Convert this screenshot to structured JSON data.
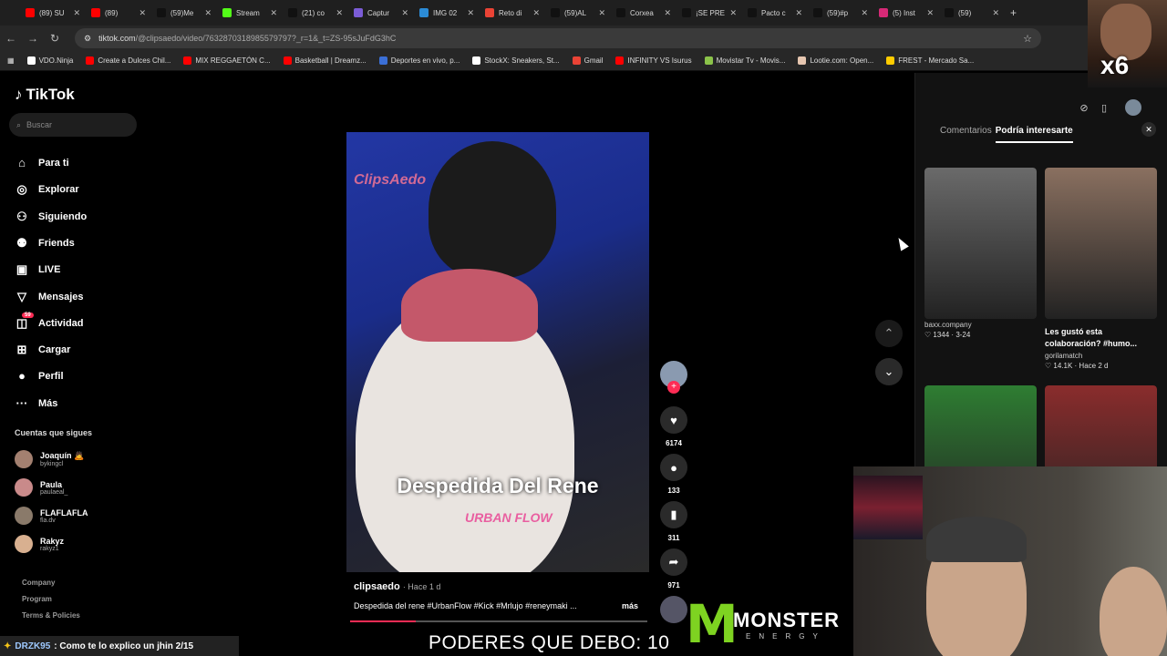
{
  "browser": {
    "tabs": [
      {
        "title": "(89) SU",
        "color": "#ff0000"
      },
      {
        "title": "(89)",
        "color": "#ff0000"
      },
      {
        "title": "(59)Me",
        "color": "#111111"
      },
      {
        "title": "Stream",
        "color": "#53fc18"
      },
      {
        "title": "(21) co",
        "color": "#111111"
      },
      {
        "title": "Captur",
        "color": "#7b5cd6"
      },
      {
        "title": "IMG 02",
        "color": "#2b8bd6"
      },
      {
        "title": "Reto di",
        "color": "#ea4335"
      },
      {
        "title": "(59)AL",
        "color": "#111111"
      },
      {
        "title": "Corxea",
        "color": "#111111"
      },
      {
        "title": "¡SE PRE",
        "color": "#111111"
      },
      {
        "title": "Pacto c",
        "color": "#111111"
      },
      {
        "title": "(59)#p",
        "color": "#111111"
      },
      {
        "title": "(5) Inst",
        "color": "#d62976"
      },
      {
        "title": "(59)",
        "color": "#111111"
      }
    ],
    "url_host": "tiktok.com",
    "url_path": "/@clipsaedo/video/7632870318985579797?_r=1&_t=ZS-95sJuFdG3hC",
    "bookmarks": [
      {
        "label": "VDO.Ninja",
        "color": "#ffffff"
      },
      {
        "label": "Create a Dulces Chil...",
        "color": "#ff0000"
      },
      {
        "label": "MIX REGGAETÓN C...",
        "color": "#ff0000"
      },
      {
        "label": "Basketball | Dreamz...",
        "color": "#ff0000"
      },
      {
        "label": "Deportes en vivo, p...",
        "color": "#3b6fd6"
      },
      {
        "label": "StockX: Sneakers, St...",
        "color": "#ffffff"
      },
      {
        "label": "Gmail",
        "color": "#ea4335"
      },
      {
        "label": "INFINITY VS Isurus",
        "color": "#ff0000"
      },
      {
        "label": "Movistar Tv - Movis...",
        "color": "#8bc34a"
      },
      {
        "label": "Lootie.com: Open...",
        "color": "#e6c6b0"
      },
      {
        "label": "FREST - Mercado Sa...",
        "color": "#ffcc00"
      }
    ]
  },
  "sidebar": {
    "logo": "TikTok",
    "search_placeholder": "Buscar",
    "nav": [
      {
        "label": "Para ti",
        "icon": "home-icon",
        "glyph": "⌂"
      },
      {
        "label": "Explorar",
        "icon": "compass-icon",
        "glyph": "◎"
      },
      {
        "label": "Siguiendo",
        "icon": "user-follow-icon",
        "glyph": "⚇"
      },
      {
        "label": "Friends",
        "icon": "friends-icon",
        "glyph": "⚉"
      },
      {
        "label": "LIVE",
        "icon": "live-icon",
        "glyph": "▣"
      },
      {
        "label": "Mensajes",
        "icon": "inbox-icon",
        "glyph": "▽"
      },
      {
        "label": "Actividad",
        "icon": "activity-icon",
        "glyph": "◫",
        "badge": "59"
      },
      {
        "label": "Cargar",
        "icon": "upload-icon",
        "glyph": "⊞"
      },
      {
        "label": "Perfil",
        "icon": "profile-avatar-icon",
        "glyph": "●"
      },
      {
        "label": "Más",
        "icon": "more-icon",
        "glyph": "···"
      }
    ],
    "following_title": "Cuentas que sigues",
    "following": [
      {
        "name": "Joaquín 🙇",
        "handle": "bykingcl",
        "color": "#a38070"
      },
      {
        "name": "Paula",
        "handle": "paulaeal_",
        "color": "#c98a8a"
      },
      {
        "name": "FLAFLAFLA",
        "handle": "fla.dv",
        "color": "#8a7a6a"
      },
      {
        "name": "Rakyz",
        "handle": "rakyz1",
        "color": "#d8b090"
      }
    ],
    "footer": [
      "Company",
      "Program",
      "Terms & Policies"
    ]
  },
  "video": {
    "watermark": "ClipsAedo",
    "caption_overlay": "Despedida Del Rene",
    "brand_overlay": "URBAN FLOW",
    "author": "clipsaedo",
    "ago": "· Hace 1 d",
    "description": "Despedida del rene #UrbanFlow #Kick #Mrlujo #reneymaki ...",
    "more": "más",
    "progress": 0.22
  },
  "actions": {
    "likes": "6174",
    "comments": "133",
    "saves": "311",
    "shares": "971"
  },
  "right_panel": {
    "tab_comments": "Comentarios",
    "tab_suggested": "Podría interesarte",
    "cards": [
      {
        "title": "",
        "author": "baxx.company",
        "likes": "1344",
        "date": "3-24",
        "color": "#6a6a6a"
      },
      {
        "title": "Les gustó esta colaboración? #humo...",
        "author": "gorilamatch",
        "likes": "14.1K",
        "date": "Hace 2 d",
        "color": "#8a7060"
      },
      {
        "title": "",
        "author": "",
        "likes": "",
        "date": "",
        "color": "#2e7d32"
      },
      {
        "title": "",
        "author": "",
        "likes": "",
        "date": "",
        "color": "#8a2c2c"
      }
    ]
  },
  "overlays": {
    "chat_user": "DRZK95",
    "chat_message": ": Como te lo explico un jhin 2/15",
    "poderes": "PODERES QUE DEBO: 10",
    "monster_word": "MONSTER",
    "monster_sub": "ENERGY",
    "meme_multiplier": "x6"
  }
}
